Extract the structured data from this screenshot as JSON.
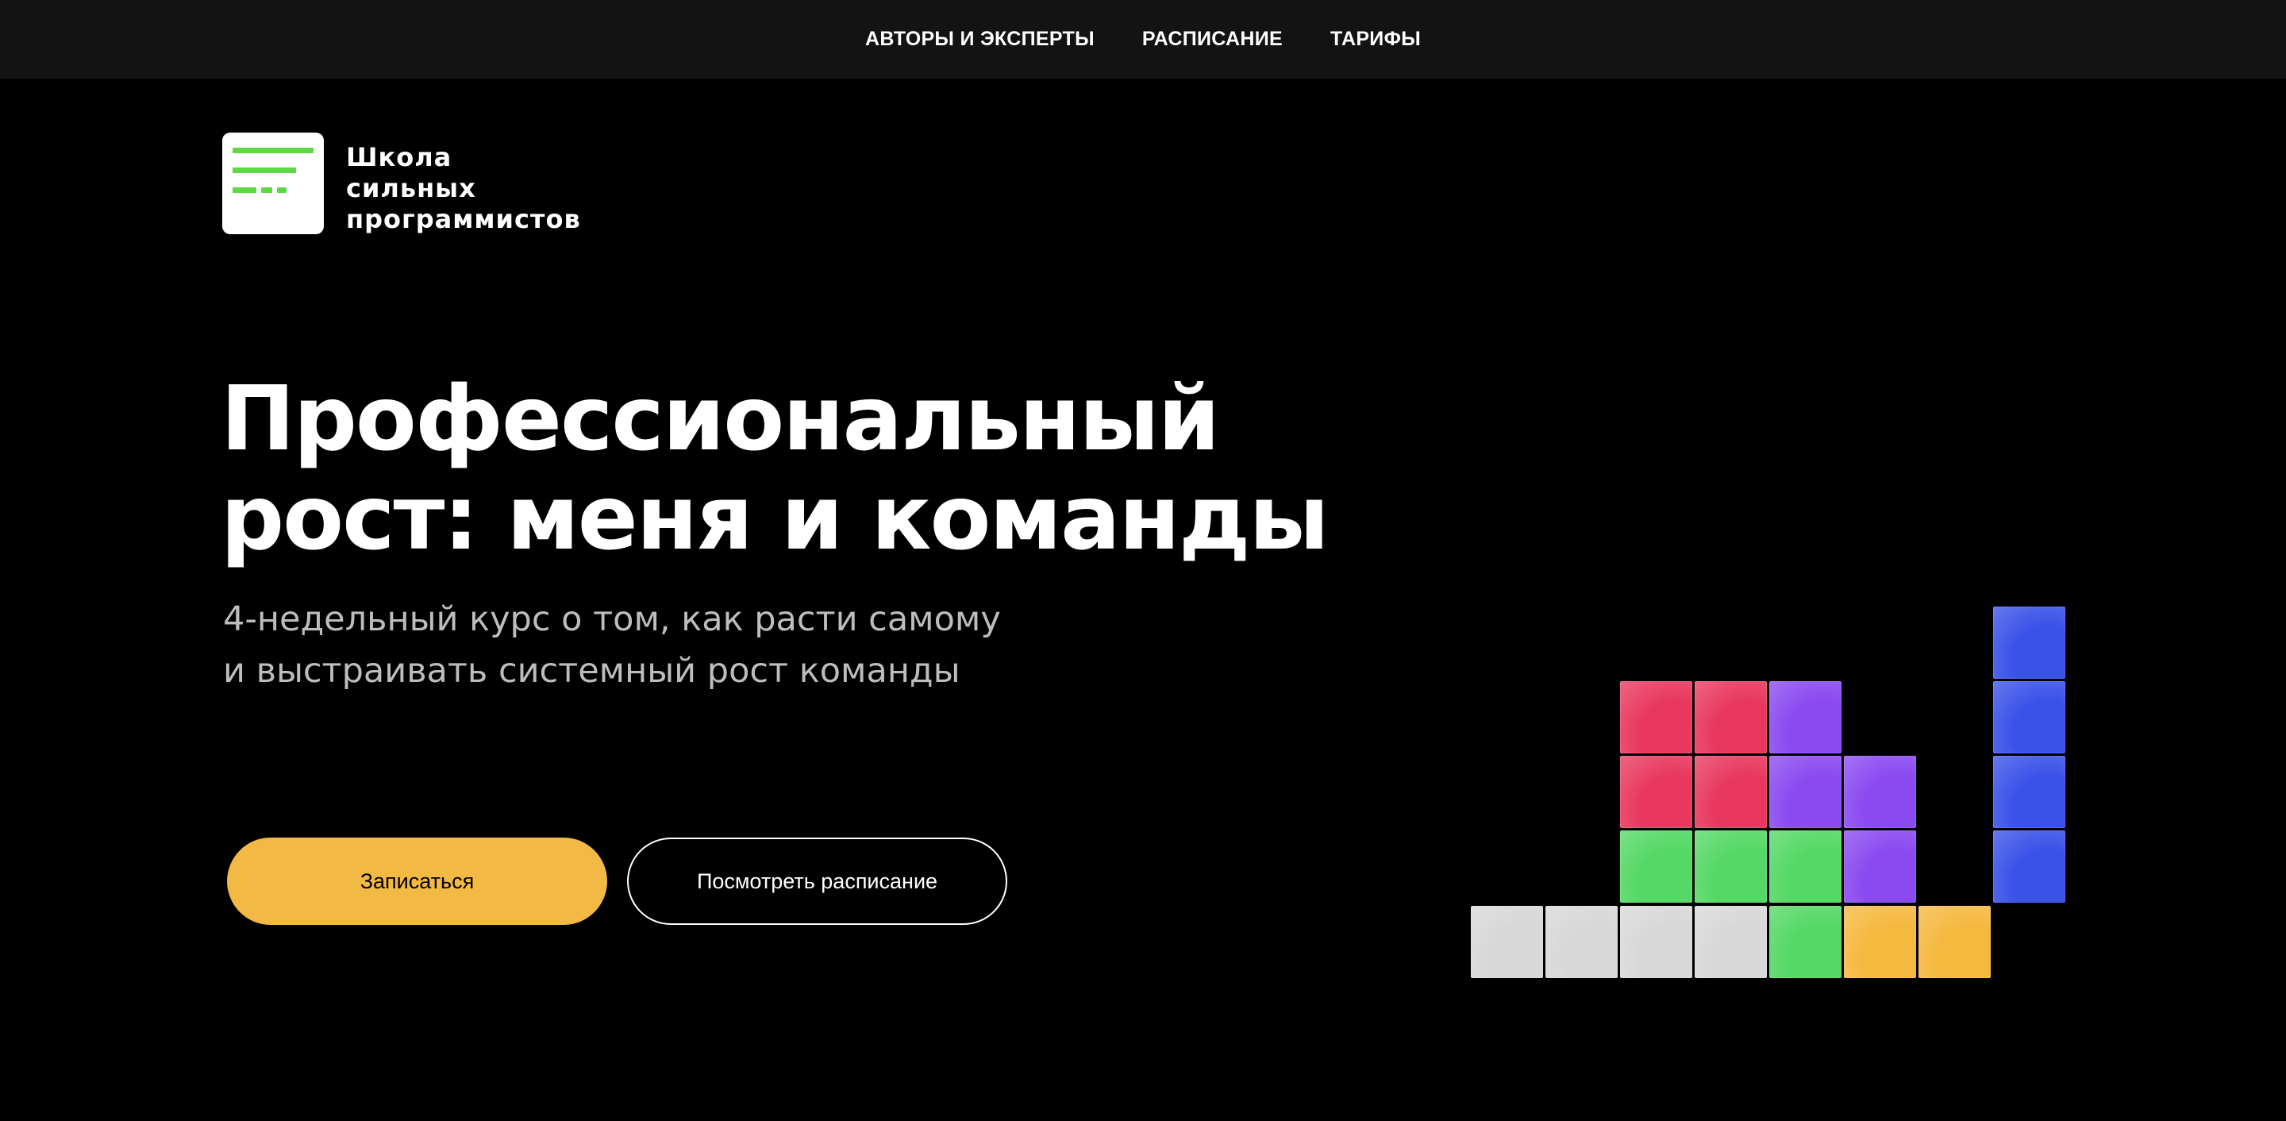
{
  "nav": {
    "items": [
      {
        "label": "АВТОРЫ И ЭКСПЕРТЫ"
      },
      {
        "label": "РАСПИСАНИЕ"
      },
      {
        "label": "ТАРИФЫ"
      }
    ]
  },
  "brand": {
    "line1": "Школа",
    "line2": "сильных",
    "line3": "программистов",
    "accent_color": "#5fd846"
  },
  "hero": {
    "title_line1": "Профессиональный",
    "title_line2": "рост: меня и команды",
    "subtitle_line1": "4-недельный курс о том, как расти самому",
    "subtitle_line2": "и выстраивать системный рост команды"
  },
  "actions": {
    "primary_label": "Записаться",
    "secondary_label": "Посмотреть расписание",
    "primary_color": "#f2b944"
  },
  "decoration": {
    "tile_colors": {
      "white": "#d8d8d8",
      "red": "#e8385f",
      "purple": "#8a4af0",
      "green": "#55d865",
      "yellow": "#f5b940",
      "blue": "#3a52e8"
    }
  }
}
